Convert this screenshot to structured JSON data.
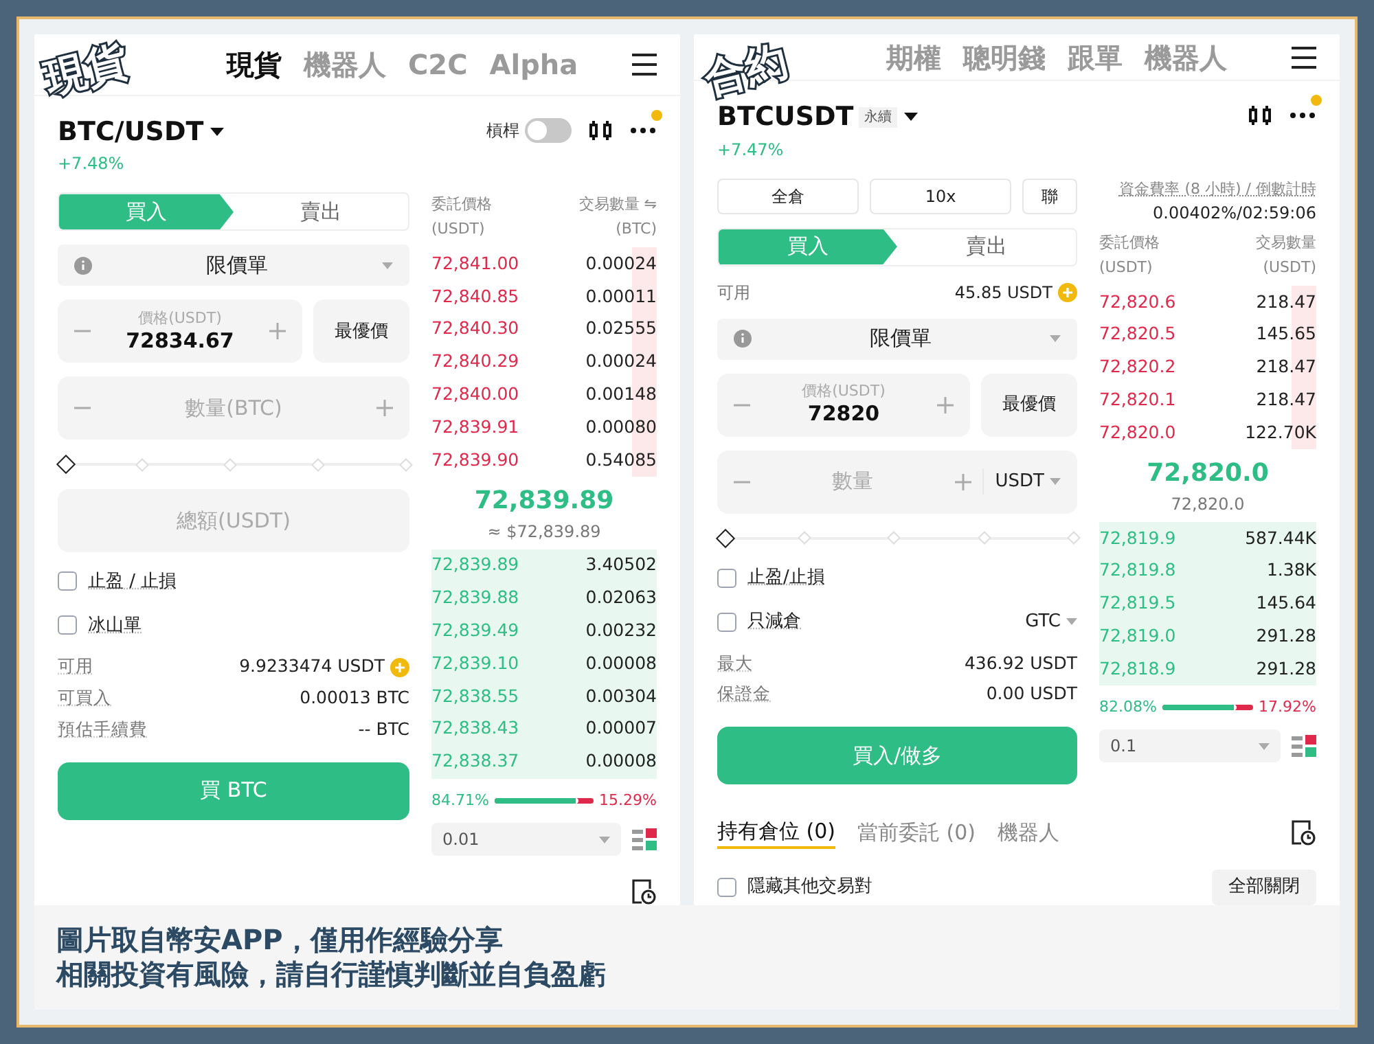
{
  "panels": [
    {
      "label": "現貨",
      "tabs": [
        {
          "label": "現貨",
          "selected": true
        },
        {
          "label": "機器人",
          "selected": false
        },
        {
          "label": "C2C",
          "selected": false
        },
        {
          "label": "Alpha",
          "selected": false
        }
      ],
      "pair": "BTC/USDT",
      "change": "+7.48%",
      "leverage": {
        "label": "槓桿",
        "on": false
      },
      "side_tabs": [
        {
          "label": "買入",
          "selected": true
        },
        {
          "label": "賣出",
          "selected": false
        }
      ],
      "order_type": "限價單",
      "price": {
        "label": "價格(USDT)",
        "value": "72834.67"
      },
      "best_price": "最優價",
      "qty": {
        "placeholder": "數量(BTC)"
      },
      "slider": {
        "level": 0
      },
      "total": {
        "placeholder": "總額(USDT)"
      },
      "options": [
        {
          "label": "止盈 / 止損",
          "checked": false
        },
        {
          "label": "冰山單",
          "checked": false
        }
      ],
      "info": [
        {
          "label": "可用",
          "value": "9.9233474 USDT",
          "kind": "balance"
        },
        {
          "label": "可買入",
          "value": "0.00013 BTC",
          "kind": "plain"
        },
        {
          "label": "預估手續費",
          "value": "-- BTC",
          "kind": "plain"
        }
      ],
      "action": "買 BTC",
      "book": {
        "price_header": "委託價格",
        "price_unit": "(USDT)",
        "qty_header": "交易數量 ⇋",
        "qty_unit": "(BTC)",
        "asks": [
          {
            "price": "72,841.00",
            "qty": "0.00024"
          },
          {
            "price": "72,840.85",
            "qty": "0.00011"
          },
          {
            "price": "72,840.30",
            "qty": "0.02555"
          },
          {
            "price": "72,840.29",
            "qty": "0.00024"
          },
          {
            "price": "72,840.00",
            "qty": "0.00148"
          },
          {
            "price": "72,839.91",
            "qty": "0.00080"
          },
          {
            "price": "72,839.90",
            "qty": "0.54085"
          }
        ],
        "last": "72,839.89",
        "last_sub": "≈ $72,839.89",
        "bids": [
          {
            "price": "72,839.89",
            "qty": "3.40502"
          },
          {
            "price": "72,839.88",
            "qty": "0.02063"
          },
          {
            "price": "72,839.49",
            "qty": "0.00232"
          },
          {
            "price": "72,839.10",
            "qty": "0.00008"
          },
          {
            "price": "72,838.55",
            "qty": "0.00304"
          },
          {
            "price": "72,838.43",
            "qty": "0.00007"
          },
          {
            "price": "72,838.37",
            "qty": "0.00008"
          }
        ],
        "ratio": {
          "buy": "84.71%",
          "sell": "15.29%",
          "level": 0.8471
        },
        "step": "0.01"
      }
    },
    {
      "label": "合約",
      "tabs": [
        {
          "label": "期權",
          "selected": false
        },
        {
          "label": "聰明錢",
          "selected": false
        },
        {
          "label": "跟單",
          "selected": false
        },
        {
          "label": "機器人",
          "selected": false
        }
      ],
      "pair": "BTCUSDT",
      "pair_tag": "永續",
      "change": "+7.47%",
      "margin_buttons": [
        "全倉",
        "10x",
        "聯"
      ],
      "side_tabs": [
        {
          "label": "買入",
          "selected": true
        },
        {
          "label": "賣出",
          "selected": false
        }
      ],
      "available": {
        "label": "可用",
        "value": "45.85 USDT"
      },
      "order_type": "限價單",
      "price": {
        "label": "價格(USDT)",
        "value": "72820"
      },
      "best_price": "最優價",
      "qty": {
        "placeholder": "數量",
        "unit": "USDT"
      },
      "slider": {
        "level": 0
      },
      "options": [
        {
          "label": "止盈/止損",
          "checked": false
        },
        {
          "label": "只減倉",
          "checked": false,
          "tif": "GTC"
        }
      ],
      "info": [
        {
          "label": "最大",
          "value": "436.92 USDT",
          "kind": "plain"
        },
        {
          "label": "保證金",
          "value": "0.00 USDT",
          "kind": "plain"
        }
      ],
      "action": "買入/做多",
      "book": {
        "funding_label": "資金費率 (8 小時) / 倒數計時",
        "funding_value": "0.00402%/02:59:06",
        "price_header": "委託價格",
        "price_unit": "(USDT)",
        "qty_header": "交易數量",
        "qty_unit": "(USDT)",
        "asks": [
          {
            "price": "72,820.6",
            "qty": "218.47"
          },
          {
            "price": "72,820.5",
            "qty": "145.65"
          },
          {
            "price": "72,820.2",
            "qty": "218.47"
          },
          {
            "price": "72,820.1",
            "qty": "218.47"
          },
          {
            "price": "72,820.0",
            "qty": "122.70K"
          }
        ],
        "last": "72,820.0",
        "last_sub": "72,820.0",
        "bids": [
          {
            "price": "72,819.9",
            "qty": "587.44K"
          },
          {
            "price": "72,819.8",
            "qty": "1.38K"
          },
          {
            "price": "72,819.5",
            "qty": "145.64"
          },
          {
            "price": "72,819.0",
            "qty": "291.28"
          },
          {
            "price": "72,818.9",
            "qty": "291.28"
          }
        ],
        "ratio": {
          "buy": "82.08%",
          "sell": "17.92%",
          "level": 0.8208
        },
        "step": "0.1"
      },
      "bottom_tabs": [
        {
          "label": "持有倉位 (0)",
          "selected": true
        },
        {
          "label": "當前委託 (0)",
          "selected": false
        },
        {
          "label": "機器人",
          "selected": false
        }
      ],
      "hide_other": {
        "label": "隱藏其他交易對",
        "checked": false
      },
      "close_all": "全部關閉"
    }
  ],
  "caption": [
    "圖片取自幣安APP，僅用作經驗分享",
    "相關投資有風險，請自行謹慎判斷並自負盈虧"
  ]
}
